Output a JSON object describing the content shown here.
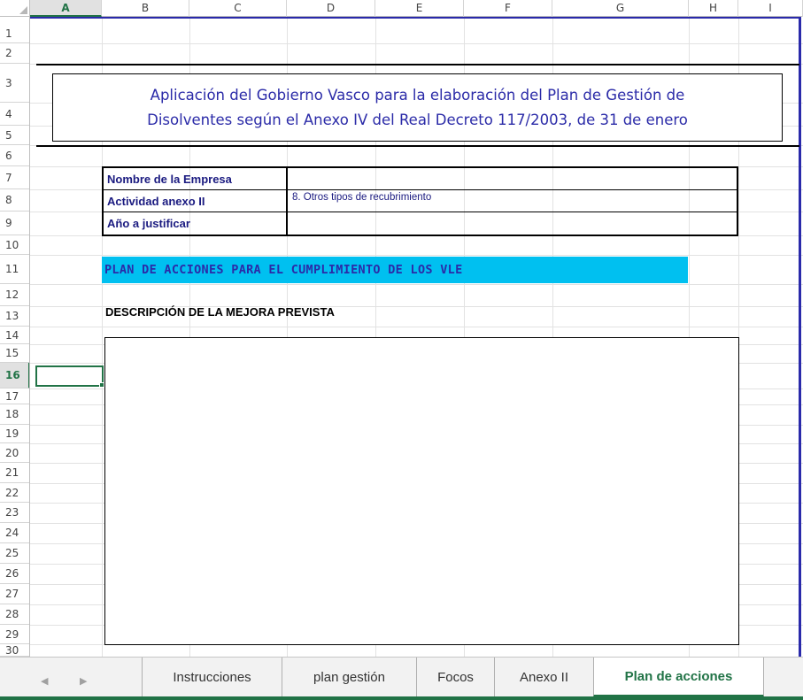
{
  "sheet": {
    "columns": [
      "A",
      "B",
      "C",
      "D",
      "E",
      "F",
      "G",
      "H",
      "I"
    ],
    "active_column": "A",
    "rows": [
      "1",
      "2",
      "3",
      "4",
      "5",
      "6",
      "7",
      "8",
      "9",
      "10",
      "11",
      "12",
      "13",
      "14",
      "15",
      "16",
      "17",
      "18",
      "19",
      "20",
      "21",
      "22",
      "23",
      "24",
      "25",
      "26",
      "27",
      "28",
      "29",
      "30"
    ],
    "active_row": "16"
  },
  "content": {
    "title_line1": "Aplicación del Gobierno Vasco para la elaboración del Plan de Gestión de",
    "title_line2": "Disolventes según el Anexo IV del Real Decreto 117/2003, de 31 de enero",
    "info": [
      {
        "label": "Nombre de la Empresa",
        "value": ""
      },
      {
        "label": "Actividad anexo II",
        "value": "8. Otros tipos de recubrimiento"
      },
      {
        "label": "Año a justificar",
        "value": ""
      }
    ],
    "plan_banner": "PLAN DE ACCIONES PARA EL CUMPLIMIENTO DE LOS VLE",
    "desc_label": "DESCRIPCIÓN DE LA MEJORA PREVISTA",
    "desc_value": ""
  },
  "tabs": [
    {
      "label": "Instrucciones",
      "active": false
    },
    {
      "label": "plan gestión",
      "active": false
    },
    {
      "label": "Focos",
      "active": false
    },
    {
      "label": "Anexo II",
      "active": false
    },
    {
      "label": "Plan de acciones",
      "active": true
    }
  ],
  "nav": {
    "prev_icon": "◀",
    "next_icon": "▶"
  },
  "colors": {
    "accent": "#217346",
    "title": "#2b2ba8",
    "banner": "#00c0f0"
  }
}
